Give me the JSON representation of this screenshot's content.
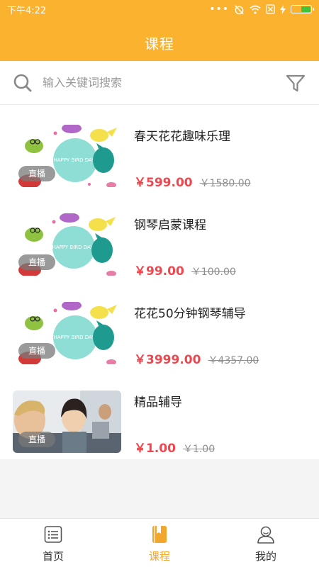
{
  "status_bar": {
    "time": "下午4:22"
  },
  "header": {
    "title": "课程"
  },
  "search": {
    "placeholder": "输入关键词搜索"
  },
  "courses": [
    {
      "title": "春天花花趣味乐理",
      "price": "￥599.00",
      "original_price": "￥1580.00",
      "badge": "直播",
      "thumb_text": "HAPPY BIRD DAY!"
    },
    {
      "title": "钢琴启蒙课程",
      "price": "￥99.00",
      "original_price": "￥100.00",
      "badge": "直播",
      "thumb_text": "HAPPY BIRD DAY!"
    },
    {
      "title": "花花50分钟钢琴辅导",
      "price": "￥3999.00",
      "original_price": "￥4357.00",
      "badge": "直播",
      "thumb_text": "HAPPY BIRD DAY!"
    },
    {
      "title": "精品辅导",
      "price": "￥1.00",
      "original_price": "￥1.00",
      "badge": "直播"
    }
  ],
  "tabs": [
    {
      "label": "首页",
      "icon": "list-icon"
    },
    {
      "label": "课程",
      "icon": "book-icon",
      "active": true
    },
    {
      "label": "我的",
      "icon": "person-icon"
    }
  ],
  "colors": {
    "accent": "#fbb22f",
    "price": "#f0464d",
    "tab_active": "#f2a62a"
  }
}
